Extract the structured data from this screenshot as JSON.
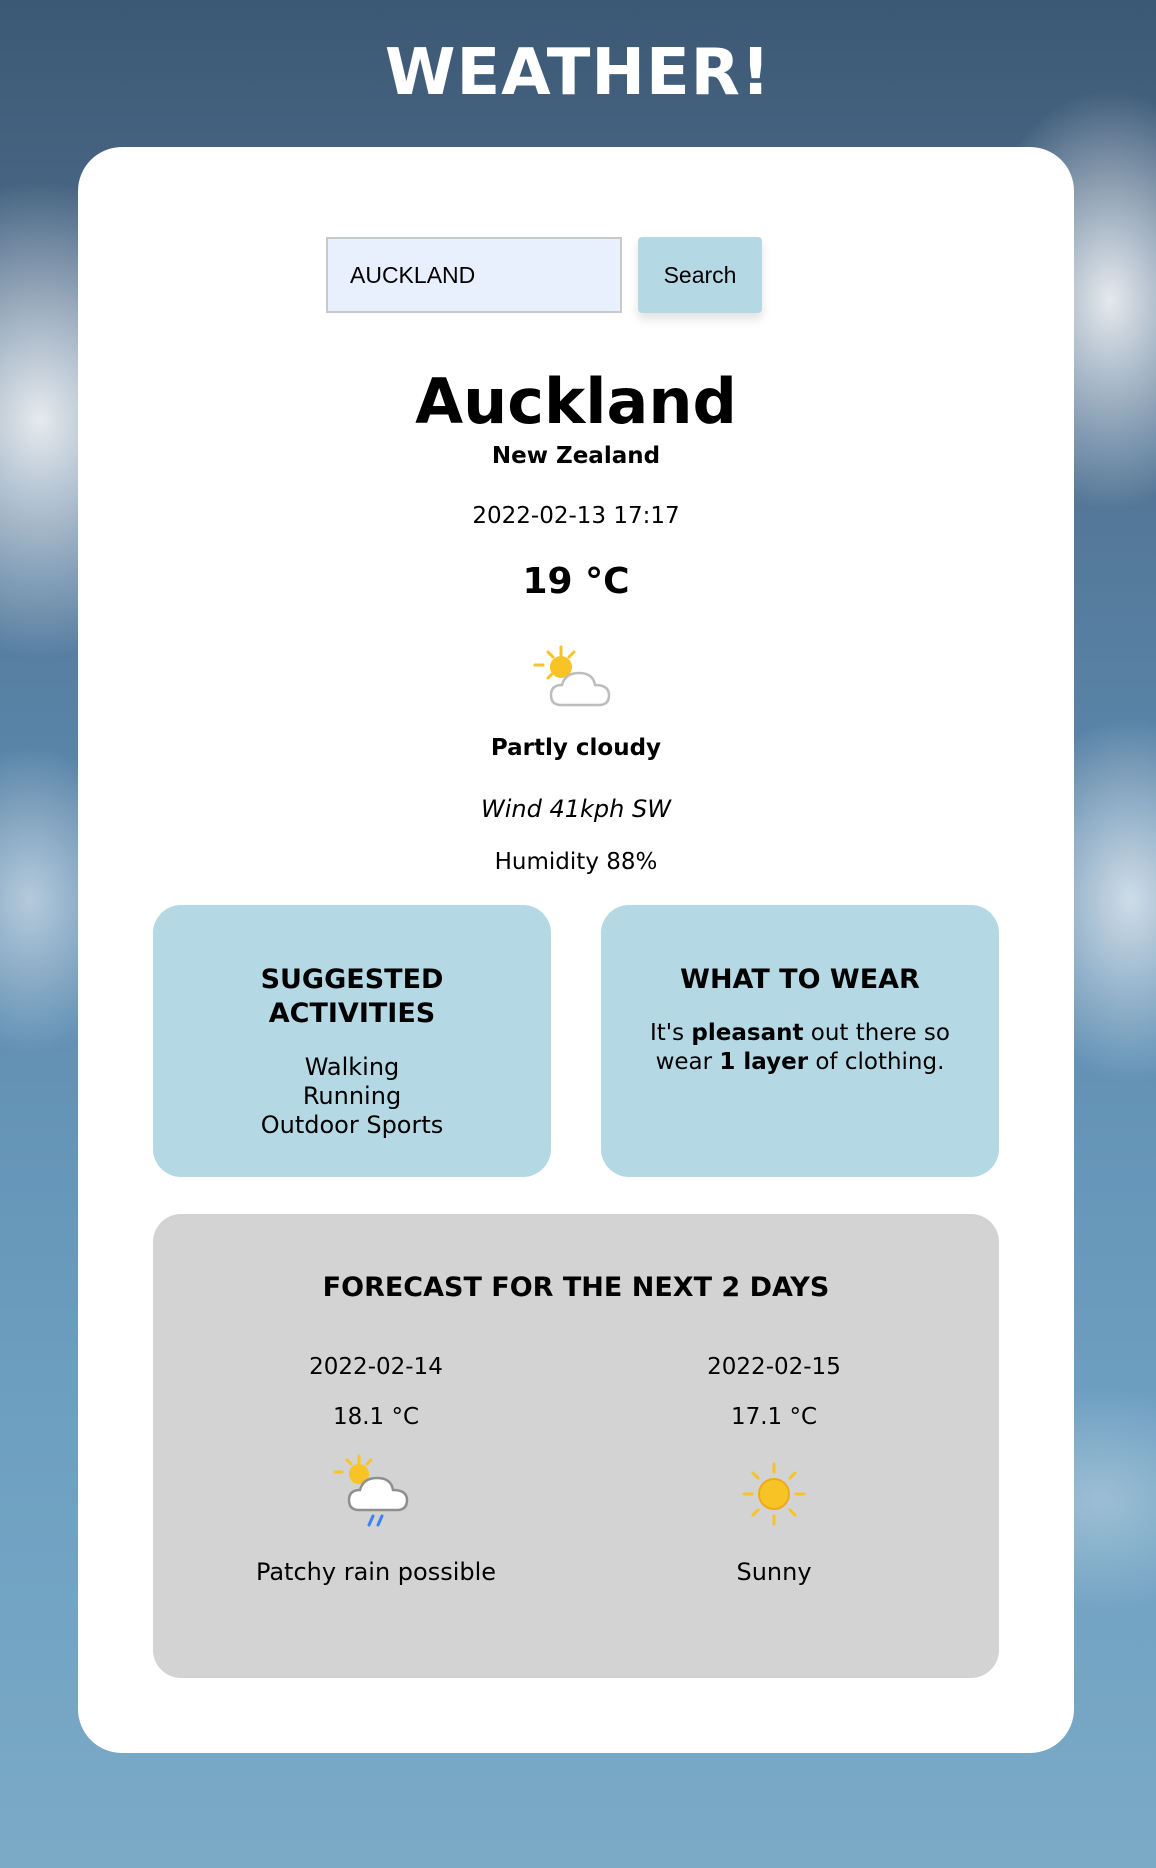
{
  "app_title": "WEATHER!",
  "search": {
    "value": "AUCKLAND",
    "button_label": "Search"
  },
  "current": {
    "city": "Auckland",
    "country": "New Zealand",
    "datetime": "2022-02-13 17:17",
    "temperature": "19 °C",
    "icon": "partly-cloudy-icon",
    "condition": "Partly cloudy",
    "wind": "Wind 41kph SW",
    "humidity": "Humidity 88%"
  },
  "activities": {
    "title_line1": "SUGGESTED",
    "title_line2": "ACTIVITIES",
    "items": [
      "Walking",
      "Running",
      "Outdoor Sports"
    ]
  },
  "wear": {
    "title": "WHAT TO WEAR",
    "text_1": "It's ",
    "text_bold_1": "pleasant",
    "text_2": " out there so wear ",
    "text_bold_2": "1 layer",
    "text_3": " of clothing."
  },
  "forecast": {
    "title": "FORECAST FOR THE NEXT 2 DAYS",
    "days": [
      {
        "date": "2022-02-14",
        "temp": "18.1 °C",
        "icon": "patchy-rain-icon",
        "condition": "Patchy rain possible"
      },
      {
        "date": "2022-02-15",
        "temp": "17.1 °C",
        "icon": "sunny-icon",
        "condition": "Sunny"
      }
    ]
  },
  "colors": {
    "card_bg": "#ffffff",
    "info_box_bg": "#b5d8e5",
    "forecast_bg": "#d3d3d3",
    "search_input_bg": "#e8f0fe",
    "sun": "#f7c325",
    "rain": "#3b82f6"
  }
}
